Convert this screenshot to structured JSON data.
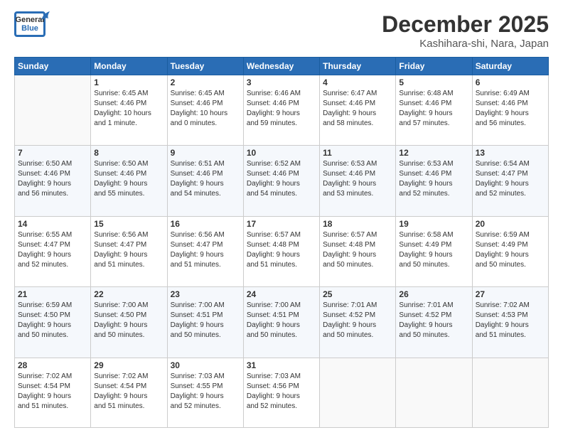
{
  "header": {
    "logo_general": "General",
    "logo_blue": "Blue",
    "month_title": "December 2025",
    "location": "Kashihara-shi, Nara, Japan"
  },
  "weekdays": [
    "Sunday",
    "Monday",
    "Tuesday",
    "Wednesday",
    "Thursday",
    "Friday",
    "Saturday"
  ],
  "weeks": [
    [
      {
        "day": "",
        "info": ""
      },
      {
        "day": "1",
        "info": "Sunrise: 6:45 AM\nSunset: 4:46 PM\nDaylight: 10 hours\nand 1 minute."
      },
      {
        "day": "2",
        "info": "Sunrise: 6:45 AM\nSunset: 4:46 PM\nDaylight: 10 hours\nand 0 minutes."
      },
      {
        "day": "3",
        "info": "Sunrise: 6:46 AM\nSunset: 4:46 PM\nDaylight: 9 hours\nand 59 minutes."
      },
      {
        "day": "4",
        "info": "Sunrise: 6:47 AM\nSunset: 4:46 PM\nDaylight: 9 hours\nand 58 minutes."
      },
      {
        "day": "5",
        "info": "Sunrise: 6:48 AM\nSunset: 4:46 PM\nDaylight: 9 hours\nand 57 minutes."
      },
      {
        "day": "6",
        "info": "Sunrise: 6:49 AM\nSunset: 4:46 PM\nDaylight: 9 hours\nand 56 minutes."
      }
    ],
    [
      {
        "day": "7",
        "info": "Sunrise: 6:50 AM\nSunset: 4:46 PM\nDaylight: 9 hours\nand 56 minutes."
      },
      {
        "day": "8",
        "info": "Sunrise: 6:50 AM\nSunset: 4:46 PM\nDaylight: 9 hours\nand 55 minutes."
      },
      {
        "day": "9",
        "info": "Sunrise: 6:51 AM\nSunset: 4:46 PM\nDaylight: 9 hours\nand 54 minutes."
      },
      {
        "day": "10",
        "info": "Sunrise: 6:52 AM\nSunset: 4:46 PM\nDaylight: 9 hours\nand 54 minutes."
      },
      {
        "day": "11",
        "info": "Sunrise: 6:53 AM\nSunset: 4:46 PM\nDaylight: 9 hours\nand 53 minutes."
      },
      {
        "day": "12",
        "info": "Sunrise: 6:53 AM\nSunset: 4:46 PM\nDaylight: 9 hours\nand 52 minutes."
      },
      {
        "day": "13",
        "info": "Sunrise: 6:54 AM\nSunset: 4:47 PM\nDaylight: 9 hours\nand 52 minutes."
      }
    ],
    [
      {
        "day": "14",
        "info": "Sunrise: 6:55 AM\nSunset: 4:47 PM\nDaylight: 9 hours\nand 52 minutes."
      },
      {
        "day": "15",
        "info": "Sunrise: 6:56 AM\nSunset: 4:47 PM\nDaylight: 9 hours\nand 51 minutes."
      },
      {
        "day": "16",
        "info": "Sunrise: 6:56 AM\nSunset: 4:47 PM\nDaylight: 9 hours\nand 51 minutes."
      },
      {
        "day": "17",
        "info": "Sunrise: 6:57 AM\nSunset: 4:48 PM\nDaylight: 9 hours\nand 51 minutes."
      },
      {
        "day": "18",
        "info": "Sunrise: 6:57 AM\nSunset: 4:48 PM\nDaylight: 9 hours\nand 50 minutes."
      },
      {
        "day": "19",
        "info": "Sunrise: 6:58 AM\nSunset: 4:49 PM\nDaylight: 9 hours\nand 50 minutes."
      },
      {
        "day": "20",
        "info": "Sunrise: 6:59 AM\nSunset: 4:49 PM\nDaylight: 9 hours\nand 50 minutes."
      }
    ],
    [
      {
        "day": "21",
        "info": "Sunrise: 6:59 AM\nSunset: 4:50 PM\nDaylight: 9 hours\nand 50 minutes."
      },
      {
        "day": "22",
        "info": "Sunrise: 7:00 AM\nSunset: 4:50 PM\nDaylight: 9 hours\nand 50 minutes."
      },
      {
        "day": "23",
        "info": "Sunrise: 7:00 AM\nSunset: 4:51 PM\nDaylight: 9 hours\nand 50 minutes."
      },
      {
        "day": "24",
        "info": "Sunrise: 7:00 AM\nSunset: 4:51 PM\nDaylight: 9 hours\nand 50 minutes."
      },
      {
        "day": "25",
        "info": "Sunrise: 7:01 AM\nSunset: 4:52 PM\nDaylight: 9 hours\nand 50 minutes."
      },
      {
        "day": "26",
        "info": "Sunrise: 7:01 AM\nSunset: 4:52 PM\nDaylight: 9 hours\nand 50 minutes."
      },
      {
        "day": "27",
        "info": "Sunrise: 7:02 AM\nSunset: 4:53 PM\nDaylight: 9 hours\nand 51 minutes."
      }
    ],
    [
      {
        "day": "28",
        "info": "Sunrise: 7:02 AM\nSunset: 4:54 PM\nDaylight: 9 hours\nand 51 minutes."
      },
      {
        "day": "29",
        "info": "Sunrise: 7:02 AM\nSunset: 4:54 PM\nDaylight: 9 hours\nand 51 minutes."
      },
      {
        "day": "30",
        "info": "Sunrise: 7:03 AM\nSunset: 4:55 PM\nDaylight: 9 hours\nand 52 minutes."
      },
      {
        "day": "31",
        "info": "Sunrise: 7:03 AM\nSunset: 4:56 PM\nDaylight: 9 hours\nand 52 minutes."
      },
      {
        "day": "",
        "info": ""
      },
      {
        "day": "",
        "info": ""
      },
      {
        "day": "",
        "info": ""
      }
    ]
  ]
}
